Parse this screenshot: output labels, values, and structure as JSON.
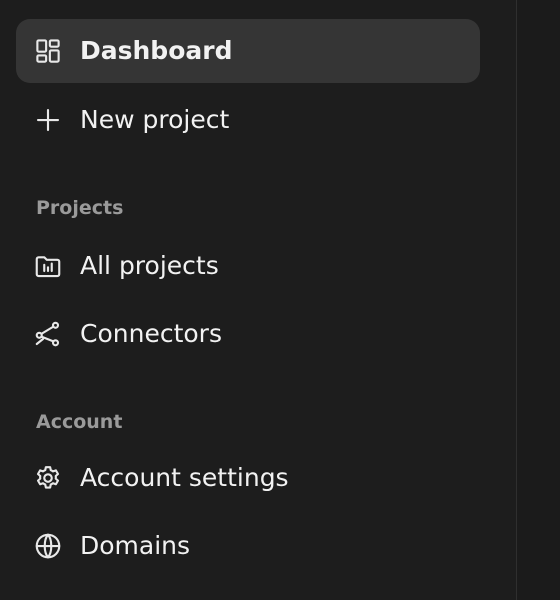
{
  "sidebar": {
    "items": {
      "dashboard": {
        "label": "Dashboard",
        "icon": "layout-grid-icon"
      },
      "new_project": {
        "label": "New project",
        "icon": "plus-icon"
      },
      "all_projects": {
        "label": "All projects",
        "icon": "folder-chart-icon"
      },
      "connectors": {
        "label": "Connectors",
        "icon": "route-icon"
      },
      "account_settings": {
        "label": "Account settings",
        "icon": "gear-icon"
      },
      "domains": {
        "label": "Domains",
        "icon": "globe-icon"
      }
    },
    "sections": {
      "projects": "Projects",
      "account": "Account"
    },
    "colors": {
      "background": "#1d1d1d",
      "active_item": "#353535",
      "section_label": "#9a9a9a",
      "text": "#f2f2f2"
    }
  }
}
